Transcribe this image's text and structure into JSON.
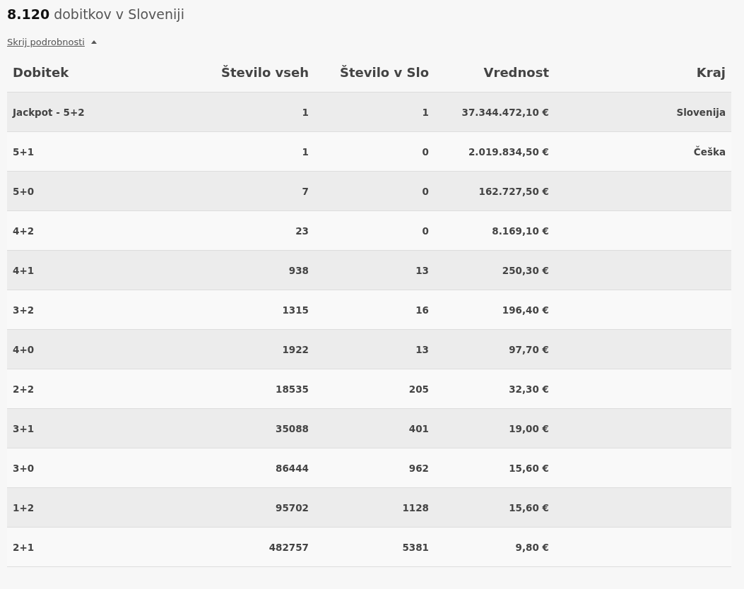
{
  "heading": "**8.120** dobitkov v Sloveniji",
  "toggle_link": {
    "label": "Skrij podrobnosti",
    "expanded": true
  },
  "table": {
    "columns": [
      "Dobitek",
      "Število vseh",
      "Število v Slo",
      "Vrednost",
      "Kraj"
    ],
    "rows": [
      {
        "prize": "Jackpot - 5+2",
        "count_all": "1",
        "count_slo": "1",
        "value": "37.344.472,10 €",
        "region": "Slovenija"
      },
      {
        "prize": "5+1",
        "count_all": "1",
        "count_slo": "0",
        "value": "2.019.834,50 €",
        "region": "Češka"
      },
      {
        "prize": "5+0",
        "count_all": "7",
        "count_slo": "0",
        "value": "162.727,50 €"
      },
      {
        "prize": "4+2",
        "count_all": "23",
        "count_slo": "0",
        "value": "8.169,10 €"
      },
      {
        "prize": "4+1",
        "count_all": "938",
        "count_slo": "13",
        "value": "250,30 €"
      },
      {
        "prize": "3+2",
        "count_all": "1315",
        "count_slo": "16",
        "value": "196,40 €"
      },
      {
        "prize": "4+0",
        "count_all": "1922",
        "count_slo": "13",
        "value": "97,70 €"
      },
      {
        "prize": "2+2",
        "count_all": "18535",
        "count_slo": "205",
        "value": "32,30 €"
      },
      {
        "prize": "3+1",
        "count_all": "35088",
        "count_slo": "401",
        "value": "19,00 €"
      },
      {
        "prize": "3+0",
        "count_all": "86444",
        "count_slo": "962",
        "value": "15,60 €"
      },
      {
        "prize": "1+2",
        "count_all": "95702",
        "count_slo": "1128",
        "value": "15,60 €"
      },
      {
        "prize": "2+1",
        "count_all": "482757",
        "count_slo": "5381",
        "value": "9,80 €"
      }
    ]
  }
}
